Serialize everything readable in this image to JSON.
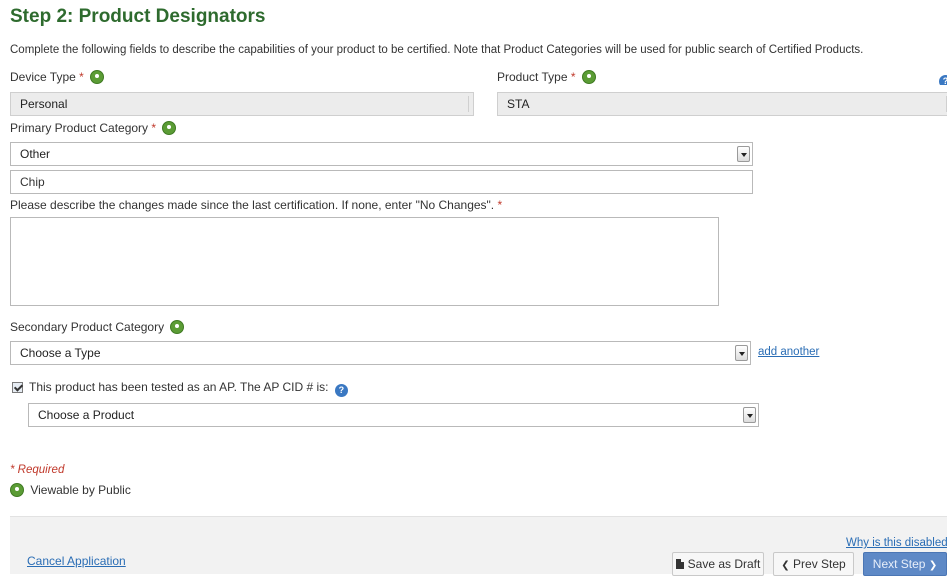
{
  "page": {
    "title": "Step 2: Product Designators",
    "intro": "Complete the following fields to describe the capabilities of your product to be certified. Note that Product Categories will be used for public search of Certified Products."
  },
  "form": {
    "device_type": {
      "label": "Device Type",
      "required_mark": "*",
      "value": "Personal"
    },
    "product_type": {
      "label": "Product Type",
      "required_mark": "*",
      "value": "STA"
    },
    "primary_category": {
      "label": "Primary Product Category",
      "required_mark": "*",
      "value": "Other",
      "other_text": "Chip"
    },
    "changes": {
      "label": "Please describe the changes made since the last certification. If none, enter \"No Changes\".",
      "required_mark": "*",
      "value": ""
    },
    "secondary_category": {
      "label": "Secondary Product Category",
      "value": "Choose a Type",
      "add_link": "add another"
    },
    "ap_tested": {
      "checked": true,
      "label": "This product has been tested as an AP. The AP CID # is:",
      "help_glyph": "?",
      "value": "Choose a Product"
    }
  },
  "legend": {
    "required": "* Required",
    "public": "Viewable by Public"
  },
  "footer": {
    "cancel": "Cancel Application",
    "why_disabled": "Why is this disabled?",
    "save_draft": "Save as Draft",
    "prev": "Prev Step",
    "next": "Next Step",
    "prev_icon": "❮",
    "next_icon": "❯"
  },
  "colors": {
    "title": "#2e6b2e",
    "public_icon": "#5b9c35",
    "required": "#c0392b",
    "link": "#2a6db5",
    "primary_button": "#5e89c6"
  },
  "icons": [
    "public-info-icon",
    "help-icon",
    "document-icon",
    "chevron-left-icon",
    "chevron-right-icon",
    "dropdown-arrow-icon"
  ]
}
